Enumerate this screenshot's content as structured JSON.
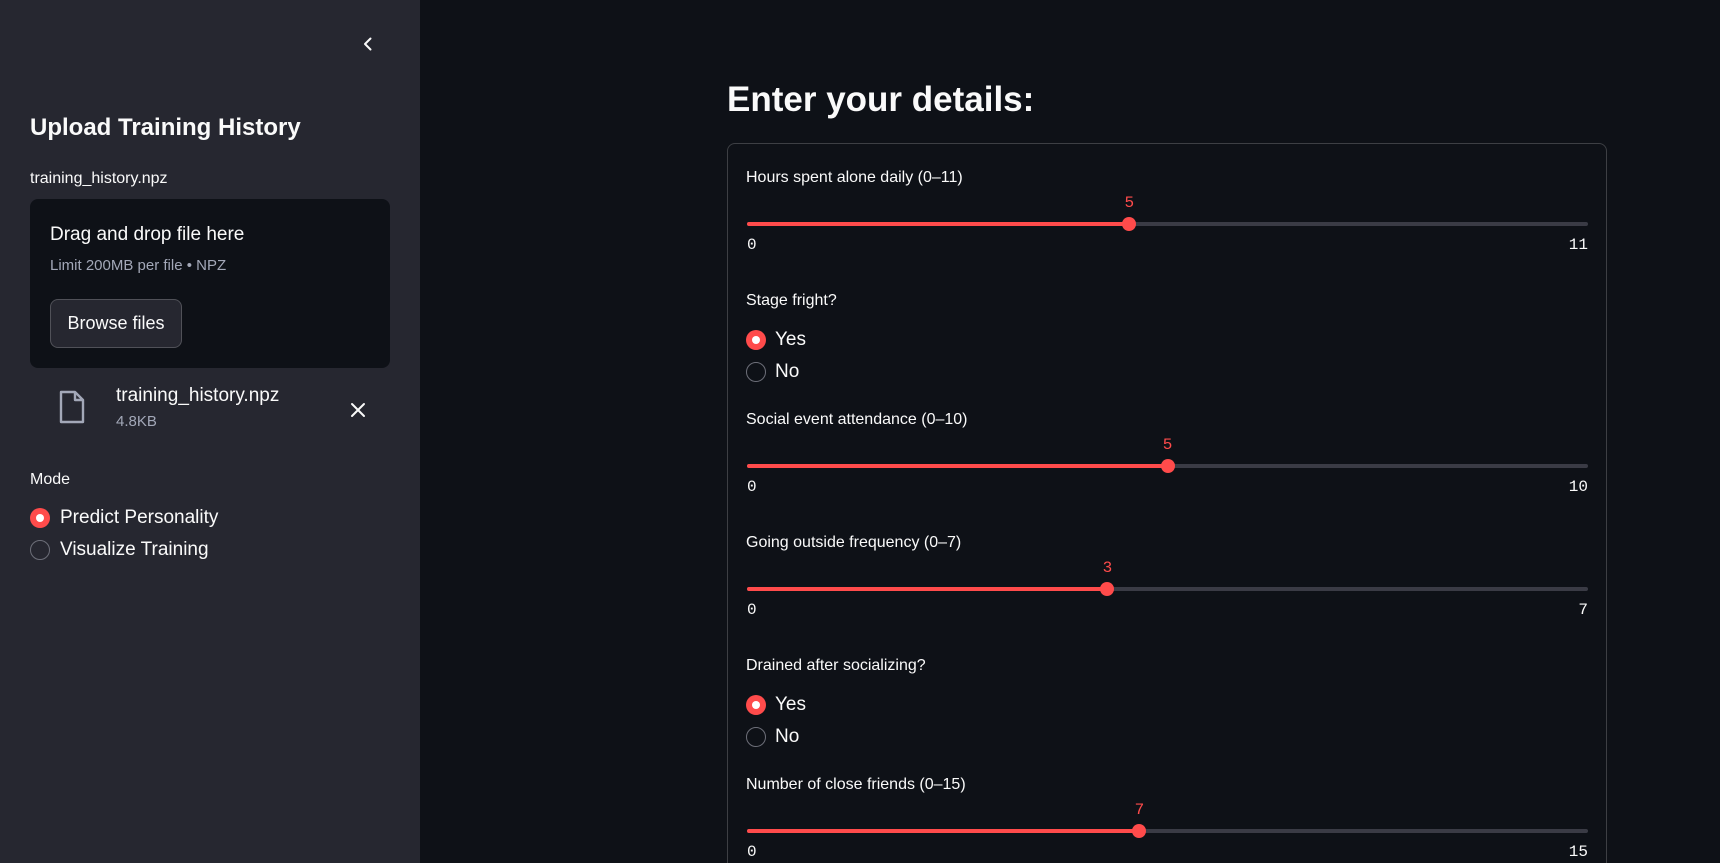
{
  "sidebar": {
    "title": "Upload Training History",
    "uploader": {
      "label": "training_history.npz",
      "drop_title": "Drag and drop file here",
      "limit_text": "Limit 200MB per file • NPZ",
      "browse_label": "Browse files"
    },
    "file": {
      "name": "training_history.npz",
      "size": "4.8KB"
    },
    "mode": {
      "label": "Mode",
      "options": [
        "Predict Personality",
        "Visualize Training"
      ],
      "selected": "Predict Personality"
    }
  },
  "main": {
    "title": "Enter your details:",
    "fields": {
      "alone": {
        "label": "Hours spent alone daily (0–11)",
        "min": 0,
        "max": 11,
        "value": 5
      },
      "stage_fright": {
        "label": "Stage fright?",
        "options": [
          "Yes",
          "No"
        ],
        "selected": "Yes"
      },
      "social": {
        "label": "Social event attendance (0–10)",
        "min": 0,
        "max": 10,
        "value": 5
      },
      "outside": {
        "label": "Going outside frequency (0–7)",
        "min": 0,
        "max": 7,
        "value": 3
      },
      "drained": {
        "label": "Drained after socializing?",
        "options": [
          "Yes",
          "No"
        ],
        "selected": "Yes"
      },
      "friends": {
        "label": "Number of close friends (0–15)",
        "min": 0,
        "max": 15,
        "value": 7
      }
    }
  },
  "colors": {
    "accent": "#ff4b4b",
    "sidebar_bg": "#262730",
    "page_bg": "#0e1117"
  },
  "icons": {
    "collapse": "chevron-left-icon",
    "file": "file-icon",
    "remove": "close-icon"
  }
}
